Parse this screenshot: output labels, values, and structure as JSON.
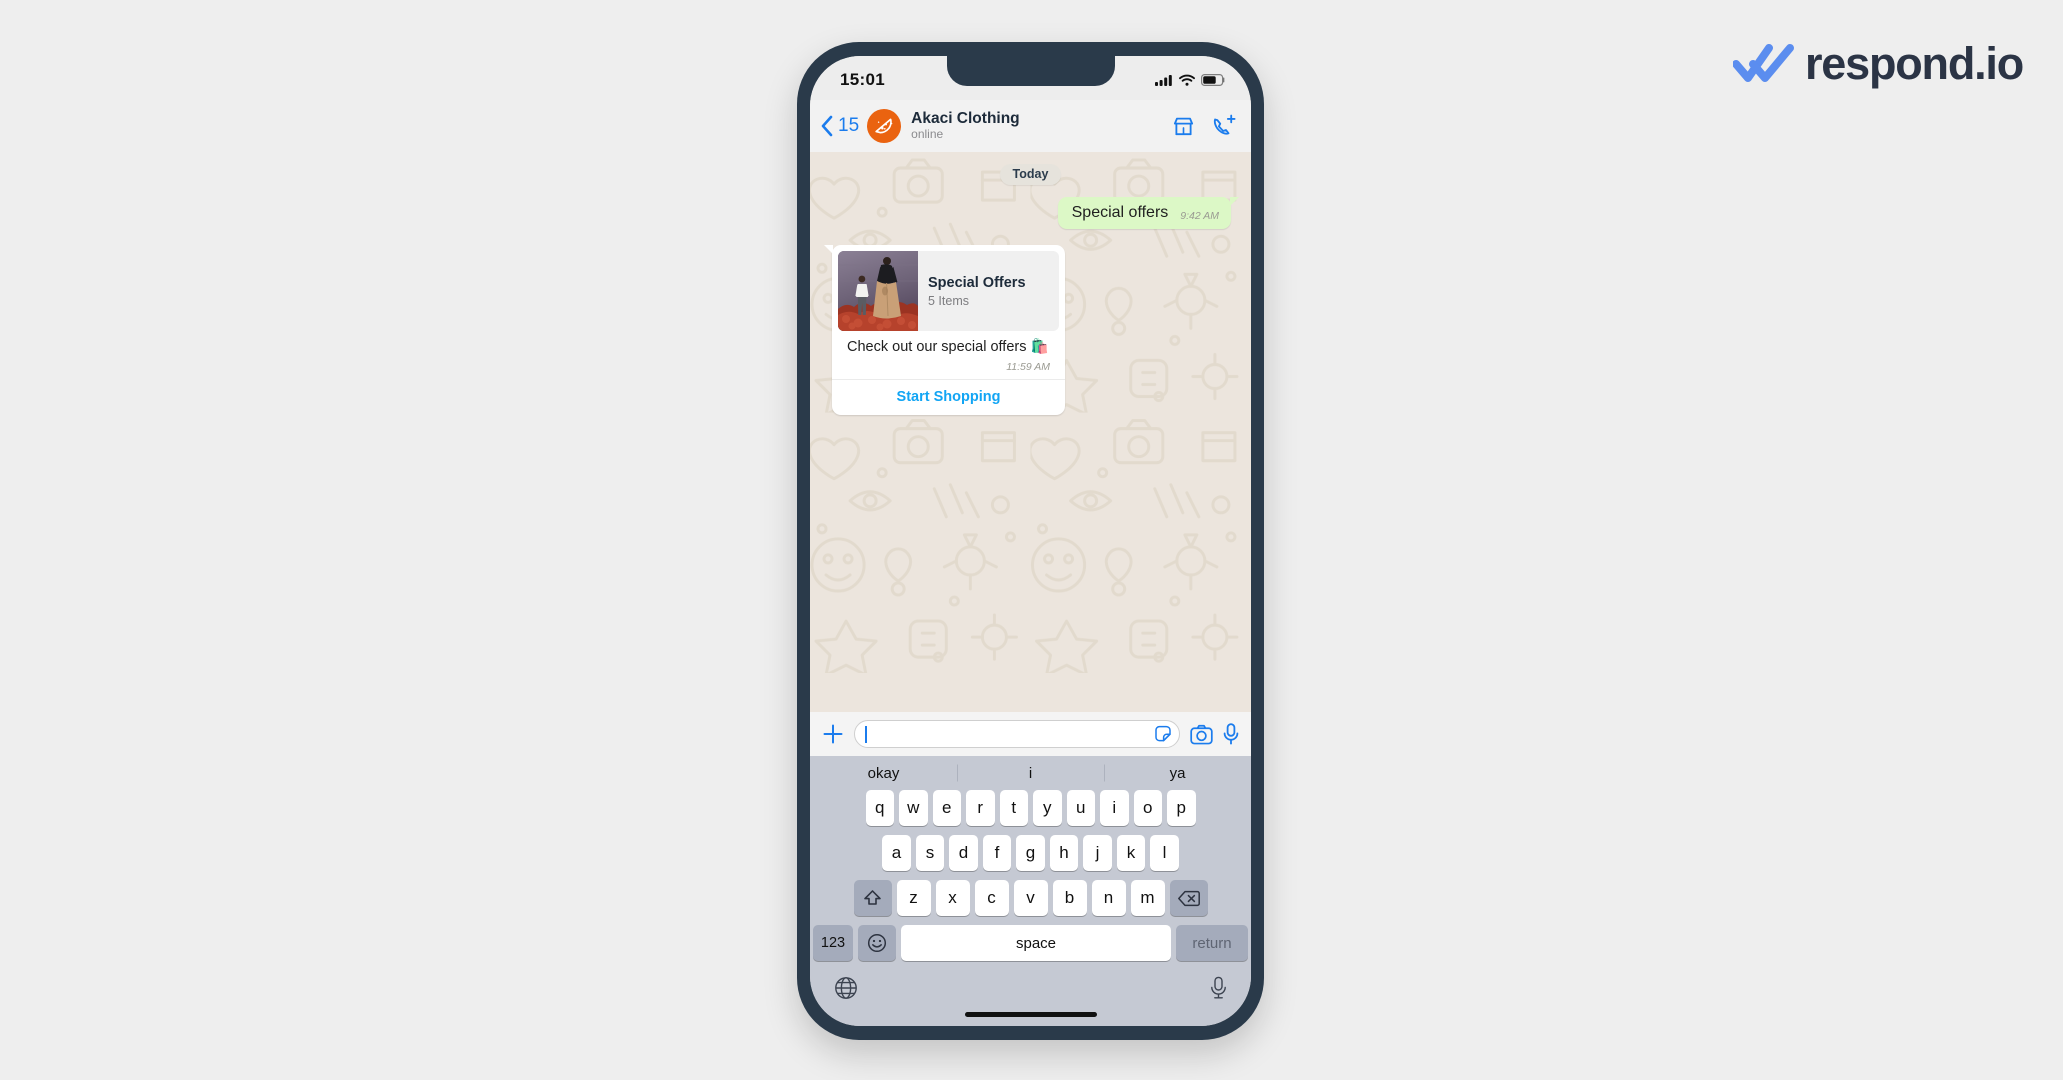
{
  "brand": {
    "name": "respond.io",
    "logo_icon": "double-check-icon",
    "mark_color": "#5b8def",
    "text_color": "#2b3445"
  },
  "phone": {
    "status_bar": {
      "time": "15:01",
      "icons": [
        "cellular-signal-icon",
        "wifi-icon",
        "battery-icon"
      ]
    },
    "chat_header": {
      "back_icon": "chevron-left-icon",
      "back_count": "15",
      "avatar_icon": "pizza-slice-icon",
      "avatar_color": "#ea6310",
      "contact_name": "Akaci Clothing",
      "contact_status": "online",
      "actions": [
        {
          "icon": "storefront-icon",
          "color": "#1b7ced"
        },
        {
          "icon": "phone-add-icon",
          "color": "#1b7ced"
        }
      ]
    },
    "chat": {
      "date_pill": "Today",
      "outgoing_message": {
        "text": "Special offers",
        "time": "9:42 AM"
      },
      "catalog_card": {
        "thumbnail_icon": "fashion-models-photo",
        "title": "Special Offers",
        "subtitle": "5 Items",
        "caption": "Check out our special offers 🛍️",
        "time": "11:59 AM",
        "cta_label": "Start Shopping",
        "cta_color": "#12a5f4"
      }
    },
    "input_bar": {
      "plus_icon": "plus-icon",
      "value": "",
      "placeholder": "",
      "sticker_icon": "sticker-icon",
      "camera_icon": "camera-icon",
      "mic_icon": "microphone-icon"
    },
    "keyboard": {
      "suggestions": [
        "okay",
        "i",
        "ya"
      ],
      "row1": [
        "q",
        "w",
        "e",
        "r",
        "t",
        "y",
        "u",
        "i",
        "o",
        "p"
      ],
      "row2": [
        "a",
        "s",
        "d",
        "f",
        "g",
        "h",
        "j",
        "k",
        "l"
      ],
      "row3": [
        "z",
        "x",
        "c",
        "v",
        "b",
        "n",
        "m"
      ],
      "shift_icon": "shift-up-icon",
      "backspace_icon": "backspace-icon",
      "numbers_label": "123",
      "emoji_icon": "emoji-smiley-icon",
      "space_label": "space",
      "return_label": "return",
      "globe_icon": "globe-icon",
      "dictation_icon": "microphone-icon"
    }
  }
}
